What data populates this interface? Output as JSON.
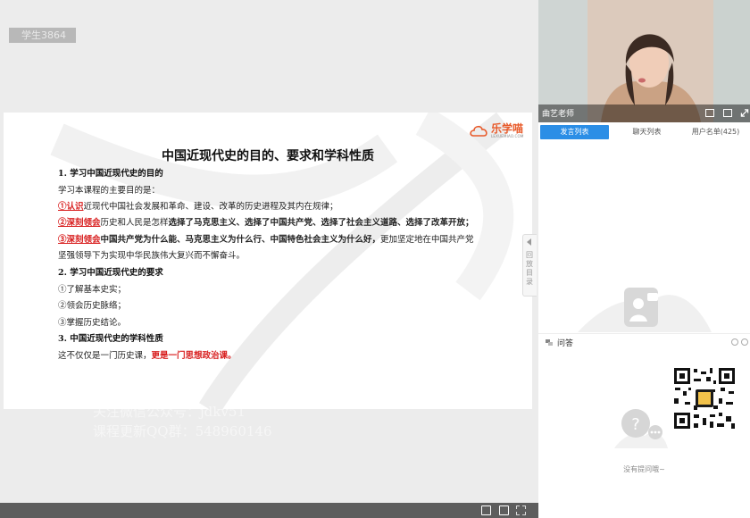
{
  "stage": {
    "watermark_id": "学生3864",
    "overlay_line1": "关注微信公众号：jdkv51",
    "overlay_line2": "课程更新QQ群：548960146"
  },
  "slide": {
    "brand": "乐学喵",
    "brand_sub": "LEXUEMIAO.COM",
    "title": "中国近现代史的目的、要求和学科性质",
    "section1": "1. 学习中国近现代史的目的",
    "intro": "学习本课程的主要目的是：",
    "item1_mark": "①认识",
    "item1_text": "近现代中国社会发展和革命、建设、改革的历史进程及其内在规律；",
    "item2_mark": "②深刻领会",
    "item2_text_a": "历史和人民是怎样",
    "item2_text_b": "选择了马克思主义、选择了中国共产党、选择了社会主义道路、选择了改革开放；",
    "item3_mark": "③深刻领会",
    "item3_text_a": "中国共产党为什么能、马克思主义为什么行、中国特色社会主义为什么好，",
    "item3_text_b": "更加坚定地在中国共产党",
    "item3_text_c": "坚强领导下为实现中华民族伟大复兴而不懈奋斗。",
    "section2": "2. 学习中国近现代史的要求",
    "req1": "①了解基本史实；",
    "req2": "②领会历史脉络；",
    "req3": "③掌握历史结论。",
    "section3": "3. 中国近现代史的学科性质",
    "nature_a": "这不仅仅是一门历史课，",
    "nature_b": "更是一门思想政治课。"
  },
  "side_tab": {
    "label": "回放目录"
  },
  "panel": {
    "teacher_name": "曲艺老师",
    "tabs": [
      {
        "label": "发言列表",
        "active": true
      },
      {
        "label": "聊天列表",
        "active": false
      },
      {
        "label": "用户名单(425)",
        "active": false
      }
    ],
    "qa_label": "问答",
    "qa_empty": "没有提问哦~"
  },
  "colors": {
    "accent": "#2b8ee6",
    "highlight_red": "#d81e1e",
    "brand_orange": "#e85a2a"
  }
}
